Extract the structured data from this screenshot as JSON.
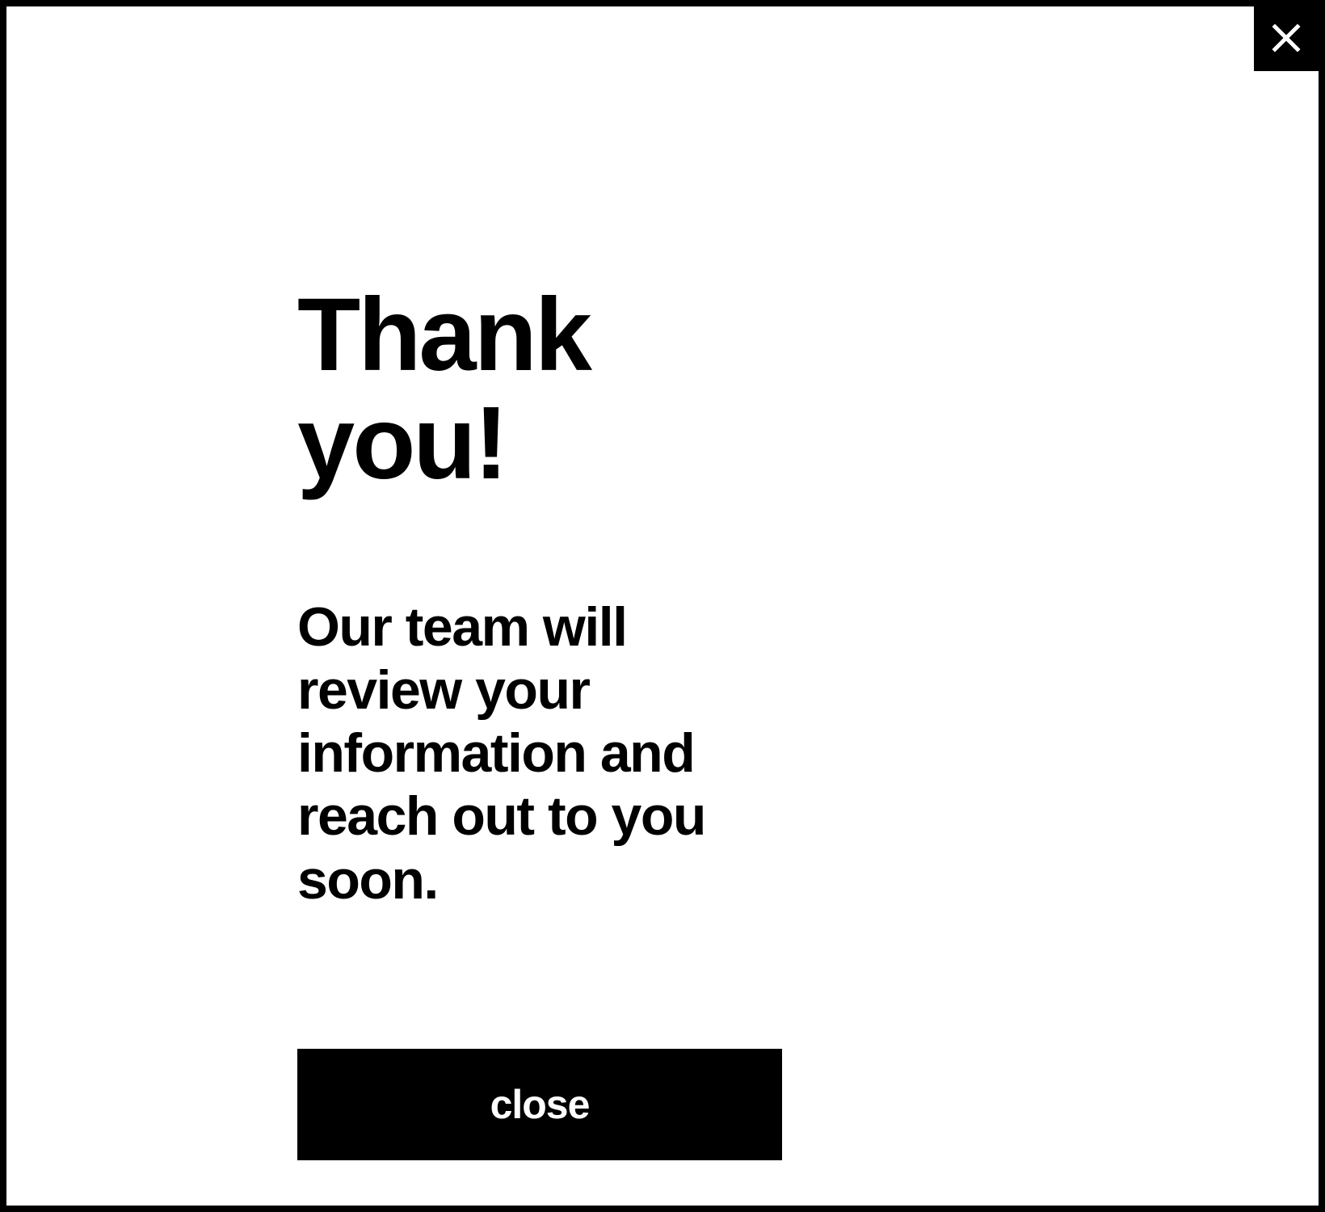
{
  "modal": {
    "heading": "Thank you!",
    "subheading": "Our team will review your information and reach out to you soon.",
    "close_button_label": "close"
  }
}
